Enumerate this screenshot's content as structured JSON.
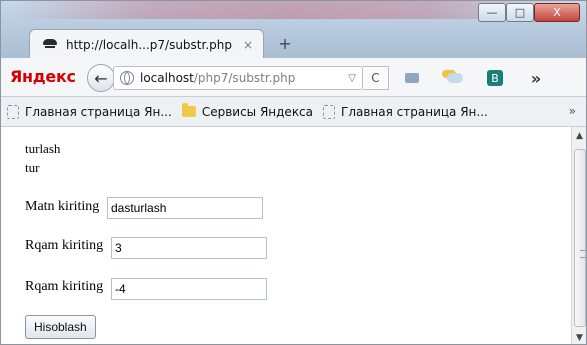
{
  "tab": {
    "title": "http://localh...p7/substr.php",
    "close_glyph": "×",
    "newtab_glyph": "+"
  },
  "window_buttons": {
    "minimize_glyph": "—",
    "maximize_glyph": "□",
    "close_glyph": "X"
  },
  "toolbar": {
    "brand": "Яндекс",
    "back_glyph": "←",
    "url_host": "localhost",
    "url_path": "/php7/substr.php",
    "url_dropdown_glyph": "▽",
    "refresh_glyph": "C",
    "more_glyph": "»",
    "icons": [
      "mail-icon",
      "weather-icon",
      "yandex-bar-icon",
      "overflow-icon",
      "menu-icon"
    ]
  },
  "bookmarks": {
    "items": [
      {
        "label": "Главная страница Ян...",
        "icon": "page-icon"
      },
      {
        "label": "Сервисы Яндекса",
        "icon": "folder-icon"
      },
      {
        "label": "Главная страница Ян...",
        "icon": "page-icon"
      }
    ],
    "chevron_glyph": "»"
  },
  "content": {
    "result_1": "turlash",
    "result_2": "tur",
    "form": {
      "fields": [
        {
          "label": "Matn kiriting",
          "value": "dasturlash"
        },
        {
          "label": "Rqam kiriting",
          "value": "3"
        },
        {
          "label": "Rqam kiriting",
          "value": "-4"
        }
      ],
      "submit_label": "Hisoblash"
    }
  },
  "colors": {
    "brand_red": "#d70000",
    "yandex_bar_teal": "#187f78",
    "folder_yellow": "#f2c84b"
  }
}
